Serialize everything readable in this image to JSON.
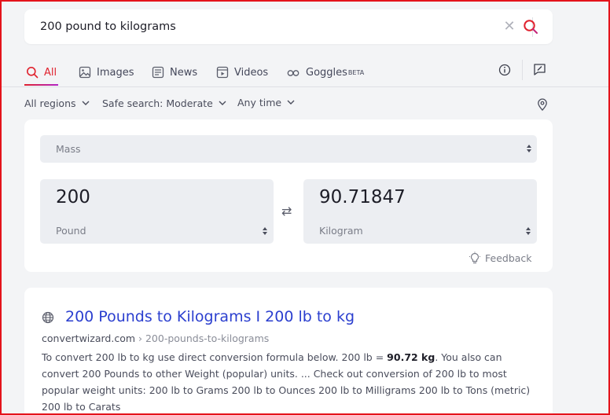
{
  "search": {
    "query": "200 pound to kilograms",
    "clear_symbol": "✕"
  },
  "tabs": [
    {
      "label": "All",
      "icon": "search-icon",
      "active": true
    },
    {
      "label": "Images",
      "icon": "image-icon"
    },
    {
      "label": "News",
      "icon": "news-icon"
    },
    {
      "label": "Videos",
      "icon": "video-icon"
    },
    {
      "label": "Goggles",
      "badge": "BETA",
      "icon": "goggles-icon"
    }
  ],
  "filters": {
    "region": "All regions",
    "safe_search": "Safe search: Moderate",
    "time": "Any time"
  },
  "converter": {
    "category": "Mass",
    "from_value": "200",
    "from_unit": "Pound",
    "to_value": "90.71847",
    "to_unit": "Kilogram",
    "swap_symbol": "⇄",
    "feedback_label": "Feedback"
  },
  "result": {
    "title": "200 Pounds to Kilograms I 200 lb to kg",
    "domain": "convertwizard.com",
    "path": " › 200-pounds-to-kilograms",
    "snippet_part1": "To convert 200 lb to kg use direct conversion formula below. 200 lb = ",
    "snippet_bold": "90.72 kg",
    "snippet_part2": ". You also can convert 200 Pounds to other Weight (popular) units. ... Check out conversion of 200 lb to most popular weight units: 200 lb to Grams 200 lb to Ounces 200 lb to Milligrams 200 lb to Tons (metric) 200 lb to Carats"
  },
  "colors": {
    "accent": "#e0222e",
    "link": "#2b3fcf",
    "frame": "#e4131b"
  }
}
